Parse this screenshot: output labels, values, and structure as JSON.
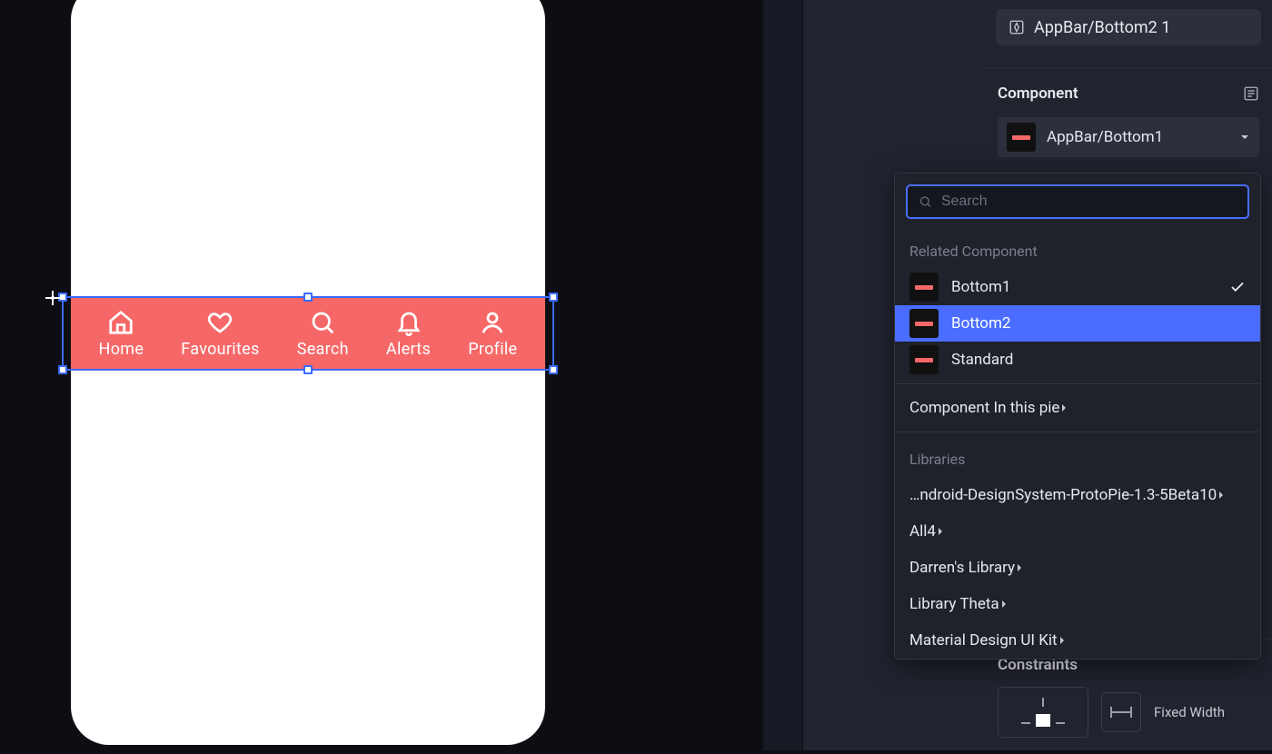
{
  "canvas": {
    "appbar": {
      "color": "#f66868",
      "items": [
        {
          "label": "Home",
          "icon": "home-icon"
        },
        {
          "label": "Favourites",
          "icon": "heart-icon"
        },
        {
          "label": "Search",
          "icon": "search-icon"
        },
        {
          "label": "Alerts",
          "icon": "bell-icon"
        },
        {
          "label": "Profile",
          "icon": "user-icon"
        }
      ]
    }
  },
  "inspector": {
    "layer_name": "AppBar/Bottom2 1",
    "component_section_title": "Component",
    "component_selector_value": "AppBar/Bottom1",
    "constraints_title": "Constraints",
    "width_mode": "Fixed Width"
  },
  "popup": {
    "search_placeholder": "Search",
    "group_related": "Related Component",
    "related_items": [
      {
        "label": "Bottom1",
        "checked": true,
        "selected": false
      },
      {
        "label": "Bottom2",
        "checked": false,
        "selected": true
      },
      {
        "label": "Standard",
        "checked": false,
        "selected": false
      }
    ],
    "component_in_pie": "Component In this pie",
    "group_libraries": "Libraries",
    "libraries": [
      "…ndroid-DesignSystem-ProtoPie-1.3-5Beta10",
      "All4",
      "Darren's Library",
      "Library Theta",
      "Material Design UI Kit"
    ]
  }
}
